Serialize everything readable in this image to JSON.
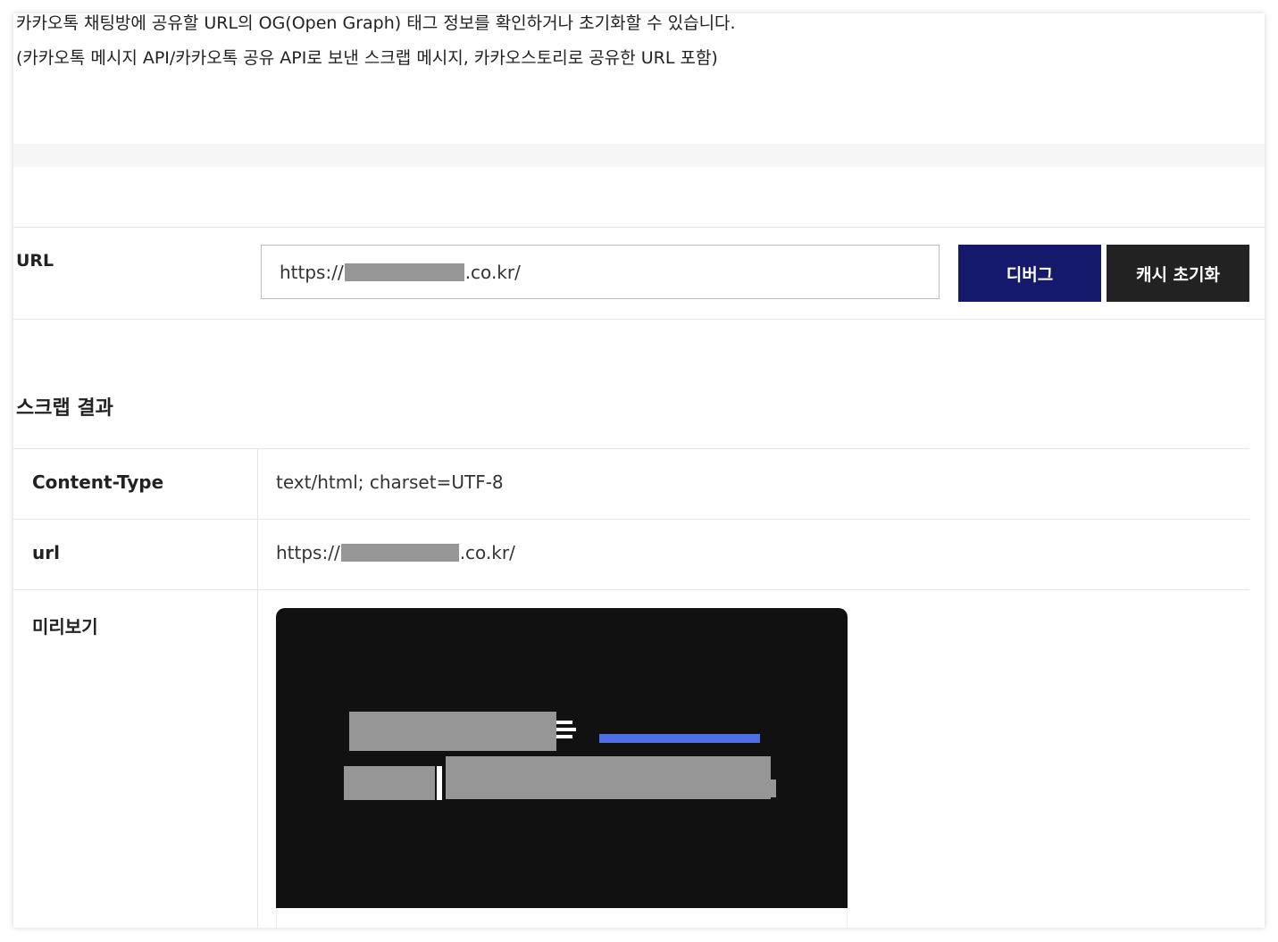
{
  "description": {
    "line1": "카카오톡 채팅방에 공유할 URL의 OG(Open Graph) 태그 정보를 확인하거나 초기화할 수 있습니다.",
    "line2": "(카카오톡 메시지 API/카카오톡 공유 API로 보낸 스크랩 메시지, 카카오스토리로 공유한 URL 포함)"
  },
  "form": {
    "url_label": "URL",
    "url_prefix": "https://",
    "url_suffix": ".co.kr/",
    "debug_button": "디버그",
    "cache_reset_button": "캐시 초기화"
  },
  "result": {
    "title": "스크랩 결과",
    "rows": [
      {
        "key": "Content-Type",
        "value": "text/html; charset=UTF-8"
      },
      {
        "key": "url",
        "value_prefix": "https://",
        "value_suffix": ".co.kr/"
      },
      {
        "key": "미리보기"
      }
    ]
  },
  "colors": {
    "debug_button": "#14196b",
    "cache_button": "#222222",
    "preview_bg": "#111111",
    "accent_bar": "#4d6ee6",
    "redaction": "#969696"
  }
}
